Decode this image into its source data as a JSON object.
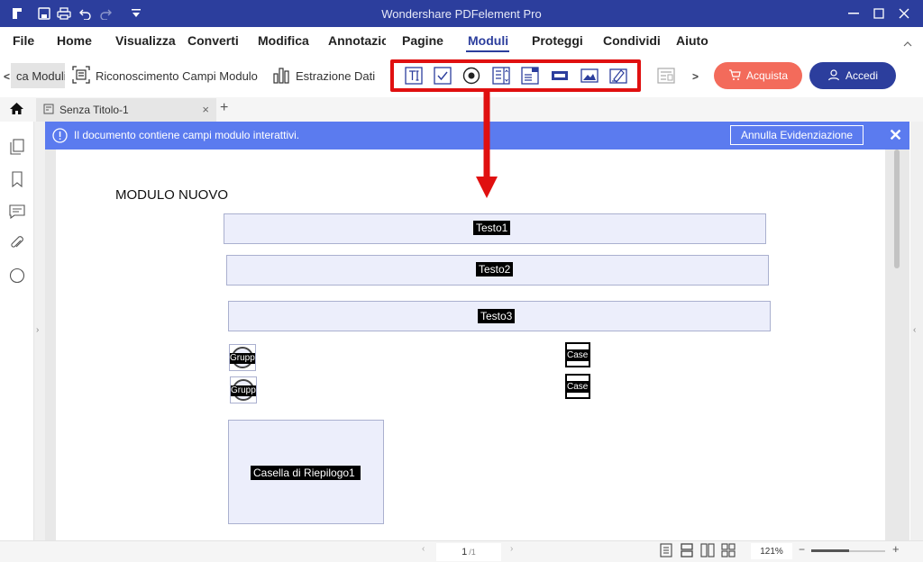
{
  "window": {
    "title": "Wondershare PDFelement Pro"
  },
  "menu": {
    "items": [
      "File",
      "Home",
      "Visualizza",
      "Converti",
      "Modifica",
      "Annotazic",
      "Pagine",
      "Moduli",
      "Proteggi",
      "Condividi",
      "Aiuto"
    ],
    "active": "Moduli"
  },
  "ribbon": {
    "scroll_left": "<",
    "scroll_right": ">",
    "items": [
      {
        "label": "ca Moduli",
        "selected": true
      },
      {
        "label": "Riconoscimento Campi Modulo",
        "icon": "form-recognition-icon"
      },
      {
        "label": "Estrazione Dati",
        "icon": "data-extraction-icon"
      }
    ],
    "form_tools": [
      "text-field-icon",
      "checkbox-icon",
      "radio-button-icon",
      "list-box-icon",
      "combo-box-icon",
      "button-field-icon",
      "image-field-icon",
      "signature-field-icon"
    ],
    "buy_label": "Acquista",
    "login_label": "Accedi"
  },
  "tabs": {
    "doc_title": "Senza Titolo-1",
    "close": "×",
    "add": "+"
  },
  "banner": {
    "message": "Il documento contiene campi modulo interattivi.",
    "highlight_button": "Annulla Evidenziazione",
    "close": "✕"
  },
  "document": {
    "title": "MODULO NUOVO",
    "text_fields": [
      "Testo1",
      "Testo2",
      "Testo3"
    ],
    "radio_labels": [
      "Grupp",
      "Grupp"
    ],
    "checkbox_labels": [
      "Case",
      "Case"
    ],
    "listbox_label": "Casella di Riepilogo1"
  },
  "status": {
    "page_current": "1",
    "page_total": "/1",
    "zoom": "121%",
    "zoom_minus": "−",
    "zoom_plus": "+"
  },
  "colors": {
    "brand": "#2c3e9d",
    "banner": "#5b7bef",
    "buy": "#f36b5b",
    "highlight": "#e01010"
  }
}
